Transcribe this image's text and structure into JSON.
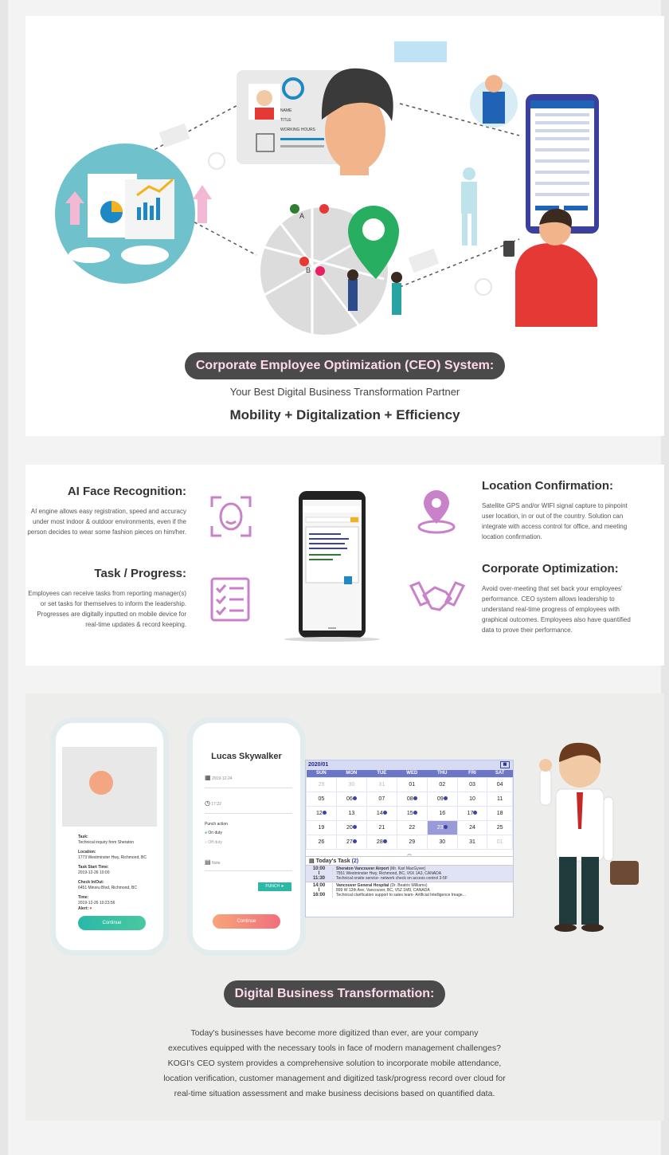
{
  "hero": {
    "badge": "Corporate Employee Optimization (CEO) System:",
    "subtitle": "Your Best Digital Business Transformation Partner",
    "tagline": "Mobility + Digitalization + Efficiency",
    "id_card_fields": [
      "NAME",
      "TITLE",
      "WORKING HOURS"
    ],
    "map_pins": [
      "A",
      "B"
    ]
  },
  "features": {
    "left": [
      {
        "title": "AI Face Recognition:",
        "text": "AI engine allows easy registration, speed and accuracy under most indoor & outdoor environments, even if the person decides to wear some fashion pieces on him/her."
      },
      {
        "title": "Task / Progress:",
        "text": "Employees can receive tasks from reporting manager(s) or set tasks for themselves to inform the leadership. Progresses are digitally inputted on mobile device for real-time updates & record keeping."
      }
    ],
    "right": [
      {
        "title": "Location Confirmation:",
        "text": "Satellite GPS and/or WIFI signal capture to pinpoint user location, in or out of the country. Solution can integrate with access control for office, and meeting location confirmation."
      },
      {
        "title": "Corporate Optimization:",
        "text": "Avoid over-meeting that set back your employees' performance. CEO system allows leadership to understand real-time progress of employees with graphical outcomes. Employees also have quantified data to prove their performance."
      }
    ]
  },
  "app": {
    "phone1": {
      "fields": [
        {
          "label": "Task:",
          "value": "Technical inquiry from Sheraton"
        },
        {
          "label": "Location:",
          "value": "1773 Westminster Hwy, Richmond, BC"
        },
        {
          "label": "Task Start Time:",
          "value": "2019-12-26 10:00"
        },
        {
          "label": "Check In/Out:",
          "value": "6451 Minoru Blvd, Richmond, BC"
        },
        {
          "label": "Time:",
          "value": "2019-12-26 10:23:56"
        }
      ],
      "alert": "Alert:",
      "button": "Continue"
    },
    "phone2": {
      "name": "Lucas Skywalker",
      "date": "2019-12-24",
      "time": "17:22",
      "punch_action": "Punch action",
      "on_duty": "On duty",
      "off_duty": "Off duty",
      "note": "Note",
      "punch": "PUNCH",
      "button": "Continue"
    },
    "calendar": {
      "month": "2020/01",
      "days": [
        "SUN",
        "MON",
        "TUE",
        "WED",
        "THU",
        "FRI",
        "SAT"
      ],
      "weeks": [
        [
          "29",
          "30",
          "31",
          "01",
          "02",
          "03",
          "04"
        ],
        [
          "05",
          "06",
          "07",
          "08",
          "09",
          "10",
          "11"
        ],
        [
          "12",
          "13",
          "14",
          "15",
          "16",
          "17",
          "18"
        ],
        [
          "19",
          "20",
          "21",
          "22",
          "23",
          "24",
          "25"
        ],
        [
          "26",
          "27",
          "28",
          "29",
          "30",
          "31",
          "01"
        ]
      ],
      "todays_task": "Today's Task",
      "task_count": "(2)",
      "tasks": [
        {
          "start": "10:00",
          "sep": "I",
          "end": "11:30",
          "place": "Sheraton Vancouver Airport",
          "contact": "(Mr. Karl MacGyver)",
          "address": "7551 Westminster Hwy, Richmond, BC, V6X 1A3, CANADA",
          "desc": "Technical onsite service- network check on access control 3-5F"
        },
        {
          "start": "14:00",
          "sep": "I",
          "end": "16:00",
          "place": "Vancouver General Hospital",
          "contact": "(Dr. Beatrix Williams)",
          "address": "899 W 12th Ave, Vancouver, BC, V5Z 1M9, CANADA",
          "desc": "Technical clarification support to sales team- Artificial Intelligence Image..."
        }
      ]
    }
  },
  "digital": {
    "badge": "Digital Business Transformation:",
    "lines": [
      "Today's businesses have become more digitized than ever, are your company",
      "executives equipped with the necessary tools in face of modern management challenges?",
      "KOGI's CEO system provides a comprehensive solution to incorporate mobile attendance,",
      "location verification, customer management and digitized task/progress record over cloud for",
      "real-time situation assessment and make business decisions based on quantified data."
    ]
  },
  "colors": {
    "badge_bg": "#4a4a4a",
    "badge_text": "#ffd9ec",
    "icon_magenta": "#c981c9",
    "calendar_header": "#6c76c6"
  }
}
